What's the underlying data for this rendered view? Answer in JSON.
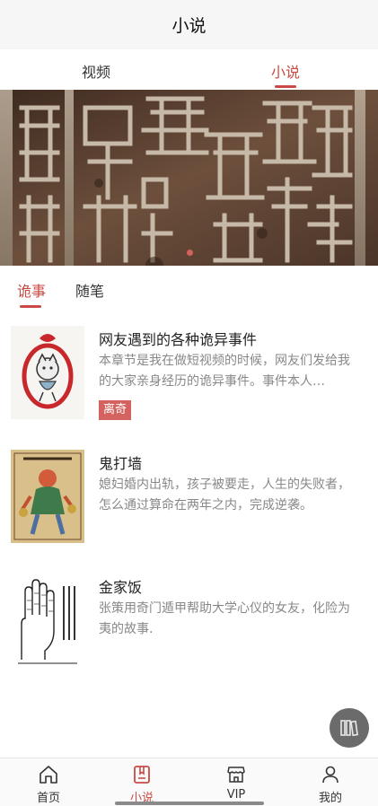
{
  "nav": {
    "title": "小说"
  },
  "top_tabs": [
    {
      "label": "视频",
      "active": false
    },
    {
      "label": "小说",
      "active": true
    }
  ],
  "banner": {
    "slides": 1,
    "active_index": 0,
    "image": "ancient-carved-characters-photo"
  },
  "sub_tabs": [
    {
      "label": "诡事",
      "active": true
    },
    {
      "label": "随笔",
      "active": false
    }
  ],
  "items": [
    {
      "title": "网友遇到的各种诡异事件",
      "desc": "本章节是我在做短视频的时候，网友们发给我的大家亲身经历的诡异事件。事件本人…",
      "tag": "离奇",
      "thumb": "cat-charm-illustration"
    },
    {
      "title": "鬼打墙",
      "desc": "媳妇婚内出轨，孩子被要走，人生的失败者，怎么通过算命在两年之内，完成逆袭。",
      "thumb": "folk-god-woodblock-print"
    },
    {
      "title": "金家饭",
      "desc": "张策用奇门遁甲帮助大学心仪的女友，化险为夷的故事.",
      "thumb": "palm-divination-diagram"
    }
  ],
  "fab": {
    "icon": "bookshelf-icon"
  },
  "tabbar": [
    {
      "label": "首页",
      "icon": "home-icon",
      "active": false
    },
    {
      "label": "小说",
      "icon": "book-icon",
      "active": true
    },
    {
      "label": "VIP",
      "icon": "store-icon",
      "active": false
    },
    {
      "label": "我的",
      "icon": "user-icon",
      "active": false
    }
  ],
  "colors": {
    "accent": "#c94a45",
    "tag_bg": "#d4625e",
    "desc": "#888888",
    "fab": "#6b6b6b"
  }
}
